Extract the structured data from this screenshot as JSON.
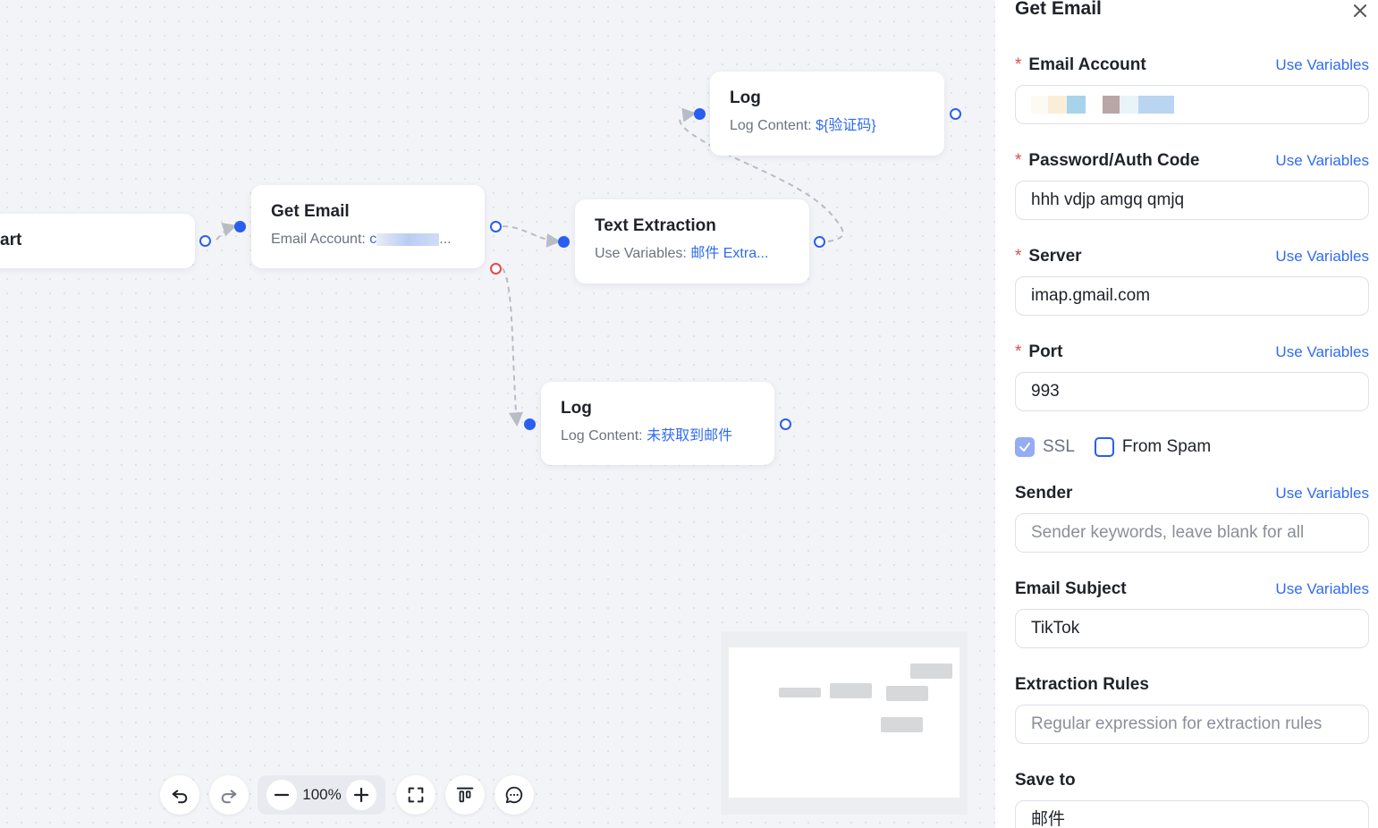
{
  "canvas": {
    "nodes": {
      "start": {
        "title": "art"
      },
      "get_email": {
        "title": "Get Email",
        "sub_label": "Email Account:",
        "sub_value": "c",
        "ellipsis": "..."
      },
      "text_extraction": {
        "title": "Text Extraction",
        "sub_label": "Use Variables:",
        "sub_value": "邮件 Extra..."
      },
      "log_top": {
        "title": "Log",
        "sub_label": "Log Content:",
        "sub_value": "${验证码}"
      },
      "log_bottom": {
        "title": "Log",
        "sub_label": "Log Content:",
        "sub_value": "未获取到邮件"
      }
    },
    "colors": {
      "port": "#2a5ef0",
      "error_port": "#e5484d",
      "edge": "#b8bcc4"
    }
  },
  "toolbar": {
    "undo_icon": "undo-icon",
    "redo_icon": "redo-icon",
    "zoom_out_icon": "minus-icon",
    "zoom_level": "100%",
    "zoom_in_icon": "plus-icon",
    "fit_icon": "fullscreen-icon",
    "align_icon": "align-top-icon",
    "comment_icon": "comment-icon"
  },
  "panel": {
    "title": "Get Email",
    "close_icon": "close-icon",
    "use_variables": "Use Variables",
    "fields": {
      "email_account": {
        "label": "Email Account",
        "required": true,
        "value": ""
      },
      "password": {
        "label": "Password/Auth Code",
        "required": true,
        "value": "hhh vdjp amgq qmjq"
      },
      "server": {
        "label": "Server",
        "required": true,
        "value": "imap.gmail.com"
      },
      "port": {
        "label": "Port",
        "required": true,
        "value": "993"
      },
      "sender": {
        "label": "Sender",
        "placeholder": "Sender keywords, leave blank for all"
      },
      "subject": {
        "label": "Email Subject",
        "value": "TikTok"
      },
      "rules": {
        "label": "Extraction Rules",
        "placeholder": "Regular expression for extraction rules"
      },
      "save_to": {
        "label": "Save to",
        "value": "邮件"
      }
    },
    "ssl": {
      "label": "SSL",
      "checked": true
    },
    "from_spam": {
      "label": "From Spam",
      "checked": false
    },
    "required_mark": "*"
  }
}
